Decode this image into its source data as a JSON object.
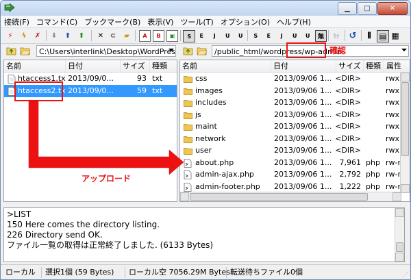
{
  "window": {
    "icons": {
      "app": "ffftp-app-icon",
      "minimize": "minimize-icon",
      "maximize": "maximize-icon",
      "close": "close-icon"
    }
  },
  "menu": [
    {
      "label": "接続(F)"
    },
    {
      "label": "コマンド(C)"
    },
    {
      "label": "ブックマーク(B)"
    },
    {
      "label": "表示(V)"
    },
    {
      "label": "ツール(T)"
    },
    {
      "label": "オプション(O)"
    },
    {
      "label": "ヘルプ(H)"
    }
  ],
  "toolbar": {
    "icons": [
      "connect-icon",
      "quick-connect-icon",
      "disconnect-icon",
      "download-icon",
      "upload-icon",
      "move-up-icon",
      "delete-icon",
      "rename-icon",
      "mkdir-icon",
      "ascii-mode-icon",
      "binary-mode-icon",
      "auto-mode-icon",
      "sjis-icon",
      "euc-icon",
      "jis-icon",
      "utf8-icon",
      "utf8bom-icon",
      "no-convert-icon",
      "kana-convert-icon",
      "refresh-icon",
      "list-view-icon",
      "detail-view-icon"
    ],
    "text_buttons": {
      "ascii": "A",
      "binary": "B",
      "enc_s1": "S",
      "enc_e1": "E",
      "enc_j1": "J",
      "enc_u1": "U",
      "enc_u8a": "U",
      "enc_s2": "S",
      "enc_e2": "E",
      "enc_j2": "J",
      "enc_u2": "U",
      "enc_u8b": "U",
      "no_convert": "無",
      "kana": "ｶﾅ"
    }
  },
  "local": {
    "path": "C:\\Users\\interlink\\Desktop\\WordPress",
    "columns": [
      "名前",
      "日付",
      "サイズ",
      "種類"
    ],
    "files": [
      {
        "name": "htaccess1.txt",
        "date": "2013/09/0...",
        "size": "93",
        "type": "txt",
        "selected": false
      },
      {
        "name": "htaccess2.txt",
        "date": "2013/09/0...",
        "size": "59",
        "type": "txt",
        "selected": true
      }
    ]
  },
  "remote": {
    "path_prefix": "/public_html/wordpress",
    "path_suffix": "/wp-admin",
    "columns": [
      "名前",
      "日付",
      "サイズ",
      "種類",
      "属性"
    ],
    "files": [
      {
        "name": "css",
        "date": "2013/09/06 1...",
        "size": "<DIR>",
        "type": "",
        "attr": "rwx",
        "kind": "folder"
      },
      {
        "name": "images",
        "date": "2013/09/06 1...",
        "size": "<DIR>",
        "type": "",
        "attr": "rwx",
        "kind": "folder"
      },
      {
        "name": "includes",
        "date": "2013/09/06 1...",
        "size": "<DIR>",
        "type": "",
        "attr": "rwx",
        "kind": "folder"
      },
      {
        "name": "js",
        "date": "2013/09/06 1...",
        "size": "<DIR>",
        "type": "",
        "attr": "rwx",
        "kind": "folder"
      },
      {
        "name": "maint",
        "date": "2013/09/06 1...",
        "size": "<DIR>",
        "type": "",
        "attr": "rwx",
        "kind": "folder"
      },
      {
        "name": "network",
        "date": "2013/09/06 1...",
        "size": "<DIR>",
        "type": "",
        "attr": "rwx",
        "kind": "folder"
      },
      {
        "name": "user",
        "date": "2013/09/06 1...",
        "size": "<DIR>",
        "type": "",
        "attr": "rwx",
        "kind": "folder"
      },
      {
        "name": "about.php",
        "date": "2013/09/06 1...",
        "size": "7,961",
        "type": "php",
        "attr": "rw-r",
        "kind": "file"
      },
      {
        "name": "admin-ajax.php",
        "date": "2013/09/06 1...",
        "size": "2,792",
        "type": "php",
        "attr": "rw-r",
        "kind": "file"
      },
      {
        "name": "admin-footer.php",
        "date": "2013/09/06 1...",
        "size": "1,222",
        "type": "php",
        "attr": "rw-r",
        "kind": "file"
      }
    ]
  },
  "log": {
    "lines": [
      ">LIST",
      "150 Here comes the directory listing.",
      "226 Directory send OK.",
      "ファイル一覧の取得は正常終了しました. (6133 Bytes)"
    ]
  },
  "status": {
    "local_label": "ローカル",
    "selection": "選択1個 (59 Bytes)",
    "free_space": "ローカル空 7056.29M Bytes",
    "queue": "転送待ちファイル0個"
  },
  "annotations": {
    "confirm_label": "確認",
    "upload_label": "アップロード",
    "colors": {
      "highlight": "#ee1111",
      "selection": "#3399ff"
    }
  }
}
